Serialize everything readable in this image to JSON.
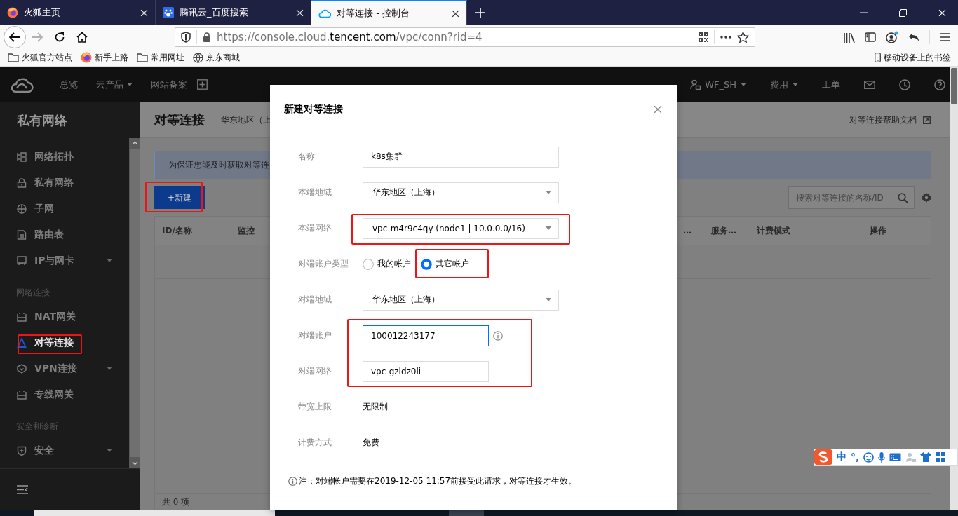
{
  "browser": {
    "tabs": [
      {
        "title": "火狐主页",
        "selected": false
      },
      {
        "title": "腾讯云_百度搜索",
        "selected": false
      },
      {
        "title": "对等连接 - 控制台",
        "selected": true
      }
    ],
    "forward_disabled": true,
    "url": {
      "host_prefix": "https://console.cloud.",
      "domain": "tencent.com",
      "path": "/vpc/conn?rid=4"
    },
    "bookmarks": [
      {
        "label": "火狐官方站点",
        "kind": "folder"
      },
      {
        "label": "新手上路",
        "kind": "firefox"
      },
      {
        "label": "常用网址",
        "kind": "folder"
      },
      {
        "label": "京东商城",
        "kind": "globe"
      }
    ],
    "mobile_bookmarks": "移动设备上的书签"
  },
  "console": {
    "nav": [
      {
        "label": "总览",
        "dropdown": false
      },
      {
        "label": "云产品",
        "dropdown": true
      },
      {
        "label": "网站备案",
        "dropdown": false
      }
    ],
    "account": {
      "label": "WF_SH",
      "dropdown": true
    },
    "right_nav": [
      {
        "label": "费用",
        "dropdown": true
      },
      {
        "label": "工单",
        "dropdown": false
      }
    ]
  },
  "sidebar": {
    "title": "私有网络",
    "sections": [
      {
        "items": [
          {
            "label": "网络拓扑",
            "expandable": false,
            "selected": false
          },
          {
            "label": "私有网络",
            "expandable": false,
            "selected": false
          },
          {
            "label": "子网",
            "expandable": false,
            "selected": false
          },
          {
            "label": "路由表",
            "expandable": false,
            "selected": false
          },
          {
            "label": "IP与网卡",
            "expandable": true,
            "selected": false
          }
        ]
      },
      {
        "heading": "网络连接",
        "items": [
          {
            "label": "NAT网关",
            "expandable": false,
            "selected": false
          },
          {
            "label": "对等连接",
            "expandable": false,
            "selected": true
          },
          {
            "label": "VPN连接",
            "expandable": true,
            "selected": false
          },
          {
            "label": "专线网关",
            "expandable": false,
            "selected": false
          }
        ]
      },
      {
        "heading": "安全和诊断",
        "items": [
          {
            "label": "安全",
            "expandable": true,
            "selected": false
          }
        ]
      }
    ]
  },
  "page": {
    "title": "对等连接",
    "region": "华东地区（上",
    "help_link": "对等连接帮助文档",
    "notice": "为保证您能及时获取对等连",
    "new_button": "+新建",
    "search": {
      "placeholder": "搜索对等连接的名称/ID"
    },
    "columns_left": [
      "ID/名称",
      "监控"
    ],
    "columns_right": [
      "…",
      "服务…",
      "计费模式",
      "操作"
    ],
    "footer": "共 0 项"
  },
  "dialog": {
    "title": "新建对等连接",
    "fields": [
      {
        "kind": "input",
        "label": "名称",
        "value": "k8s集群",
        "focused": false,
        "info": false
      },
      {
        "kind": "select",
        "label": "本端地域",
        "value": "华东地区（上海）"
      },
      {
        "kind": "select",
        "label": "本端网络",
        "value": "vpc-m4r9c4qy (node1 | 10.0.0.0/16)"
      },
      {
        "kind": "radio",
        "label": "对端账户类型",
        "options": [
          {
            "label": "我的帐户",
            "selected": false
          },
          {
            "label": "其它帐户",
            "selected": true
          }
        ]
      },
      {
        "kind": "select",
        "label": "对端地域",
        "value": "华东地区（上海）"
      },
      {
        "kind": "short_input",
        "label": "对端账户",
        "value": "100012243177",
        "focused": true,
        "info": true
      },
      {
        "kind": "short_input",
        "label": "对端网络",
        "value": "vpc-gzldz0li",
        "focused": false,
        "info": false
      },
      {
        "kind": "text",
        "label": "带宽上限",
        "value": "无限制"
      },
      {
        "kind": "text",
        "label": "计费方式",
        "value": "免费"
      }
    ],
    "note": "注：对端帐户需要在2019-12-05 11:57前接受此请求，对等连接才生效。"
  },
  "ime": {
    "mode": "中",
    "punctuation": "°,"
  }
}
